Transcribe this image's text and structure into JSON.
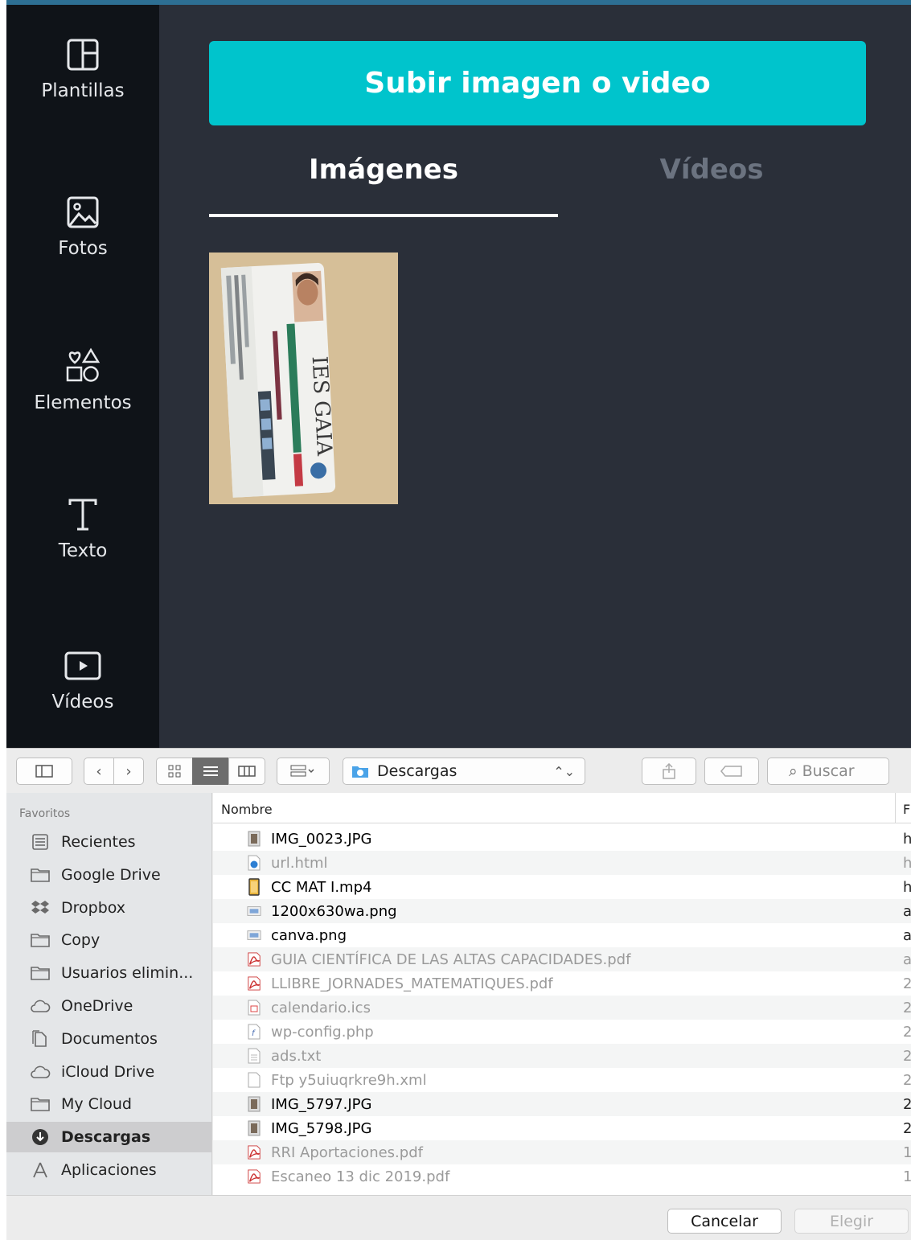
{
  "canva": {
    "rail": [
      {
        "label": "Plantillas",
        "icon": "templates-icon"
      },
      {
        "label": "Fotos",
        "icon": "photo-icon"
      },
      {
        "label": "Elementos",
        "icon": "shapes-icon"
      },
      {
        "label": "Texto",
        "icon": "text-icon"
      },
      {
        "label": "Vídeos",
        "icon": "video-icon"
      }
    ],
    "upload_label": "Subir imagen o video",
    "tabs": [
      {
        "label": "Imágenes"
      },
      {
        "label": "Vídeos"
      }
    ],
    "thumbnail_text": "IES GAIA",
    "colors": {
      "accent": "#00c4cc",
      "rail_bg": "#0f1318",
      "panel_bg": "#2a2f39"
    }
  },
  "dialog": {
    "location": "Descargas",
    "search_placeholder": "Buscar",
    "sidebar_heading": "Favoritos",
    "sidebar": [
      {
        "label": "Recientes",
        "icon": "recents-icon"
      },
      {
        "label": "Google Drive",
        "icon": "folder-icon"
      },
      {
        "label": "Dropbox",
        "icon": "dropbox-icon"
      },
      {
        "label": "Copy",
        "icon": "folder-icon"
      },
      {
        "label": "Usuarios elimin...",
        "icon": "folder-icon"
      },
      {
        "label": "OneDrive",
        "icon": "cloud-icon"
      },
      {
        "label": "Documentos",
        "icon": "documents-icon"
      },
      {
        "label": "iCloud Drive",
        "icon": "cloud-icon"
      },
      {
        "label": "My Cloud",
        "icon": "folder-icon"
      },
      {
        "label": "Descargas",
        "icon": "download-icon",
        "selected": true
      },
      {
        "label": "Aplicaciones",
        "icon": "applications-icon"
      }
    ],
    "column_name": "Nombre",
    "column_date_hint": "F",
    "files": [
      {
        "name": "IMG_0023.JPG",
        "date": "h",
        "icon": "image-file-icon",
        "dim": false
      },
      {
        "name": "url.html",
        "date": "h",
        "icon": "html-file-icon",
        "dim": true
      },
      {
        "name": "CC MAT I.mp4",
        "date": "h",
        "icon": "video-file-icon",
        "dim": false
      },
      {
        "name": "1200x630wa.png",
        "date": "a",
        "icon": "png-file-icon",
        "dim": false
      },
      {
        "name": "canva.png",
        "date": "a",
        "icon": "png-file-icon",
        "dim": false
      },
      {
        "name": "GUIA CIENTÍFICA DE LAS ALTAS CAPACIDADES.pdf",
        "date": "a",
        "icon": "pdf-file-icon",
        "dim": true
      },
      {
        "name": "LLIBRE_JORNADES_MATEMATIQUES.pdf",
        "date": "2",
        "icon": "pdf-file-icon",
        "dim": true
      },
      {
        "name": "calendario.ics",
        "date": "2",
        "icon": "calendar-file-icon",
        "dim": true
      },
      {
        "name": "wp-config.php",
        "date": "2",
        "icon": "php-file-icon",
        "dim": true
      },
      {
        "name": "ads.txt",
        "date": "2",
        "icon": "text-file-icon",
        "dim": true
      },
      {
        "name": "Ftp y5uiuqrkre9h.xml",
        "date": "2",
        "icon": "xml-file-icon",
        "dim": true
      },
      {
        "name": "IMG_5797.JPG",
        "date": "2",
        "icon": "image-file-icon",
        "dim": false
      },
      {
        "name": "IMG_5798.JPG",
        "date": "2",
        "icon": "image-file-icon",
        "dim": false
      },
      {
        "name": "RRI Aportaciones.pdf",
        "date": "1",
        "icon": "pdf-file-icon",
        "dim": true
      },
      {
        "name": "Escaneo 13 dic 2019.pdf",
        "date": "1",
        "icon": "pdf-file-icon",
        "dim": true
      }
    ],
    "cancel_label": "Cancelar",
    "choose_label": "Elegir"
  }
}
